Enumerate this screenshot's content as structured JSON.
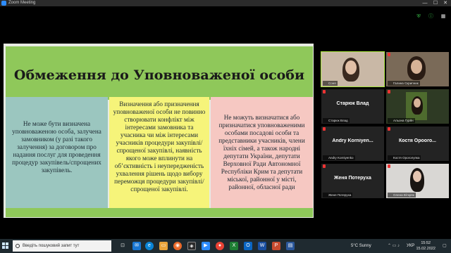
{
  "window": {
    "title": "Zoom Meeting",
    "minimize_glyph": "—",
    "maximize_glyph": "☐",
    "close_glyph": "✕"
  },
  "toolbar": {
    "icons": [
      "shield-icon",
      "info-icon",
      "view-icon"
    ]
  },
  "slide": {
    "title": "Обмеження до Уповноваженої особи",
    "col1": "Не може бути визначена уповноваженою особа, залучена замовником (у разі такого залучення) за договором про надання послуг для проведення процедур закупівель/спрощених закупівель.",
    "col2": "Визначення або призначення уповноваженої особи не повинно створювати конфлікт між інтересами замовника та учасника чи між інтересами учасників процедури закупівлі/спрощеної закупівлі, наявність якого може вплинути на об’єктивність і неупередженість ухвалення рішень щодо вибору переможця процедури закупівлі/спрощеної закупівлі.",
    "col3": "Не можуть визначатися або призначатися уповноваженими особами посадові особи та представники учасників, члени їхніх сімей, а також народні депутати України, депутати Верховної Ради Автономної Республіки Крим та депутати міської, районної у місті, районної, обласної ради"
  },
  "participants": [
    {
      "display_name": "",
      "label": "Соня",
      "video": true
    },
    {
      "display_name": "",
      "label": "Галина Скрипник",
      "video": true
    },
    {
      "display_name": "Старюк Влад",
      "label": "Старюк Влад",
      "video": false
    },
    {
      "display_name": "",
      "label": "Альона Гурйн",
      "video": true
    },
    {
      "display_name": "Andry Korniyen...",
      "label": "Andry Korniyenko",
      "video": false
    },
    {
      "display_name": "Костя Ороого...",
      "label": "Костя Ороголупка",
      "video": false
    },
    {
      "display_name": "Женя Потеруха",
      "label": "Женя Потеруха",
      "video": false
    },
    {
      "display_name": "",
      "label": "Олена Віткряк",
      "video": true
    }
  ],
  "taskbar": {
    "search_placeholder": "Введіть пошуковий запит тут",
    "weather": "5°C  Sunny",
    "language": "УКР",
    "time": "15:52",
    "date": "15.02.2022"
  },
  "colors": {
    "slide_green": "#8fc85a",
    "col1": "#9bc6bf",
    "col2": "#f6f47a",
    "col3": "#f6c8c2",
    "active_speaker": "#a7e53a"
  }
}
